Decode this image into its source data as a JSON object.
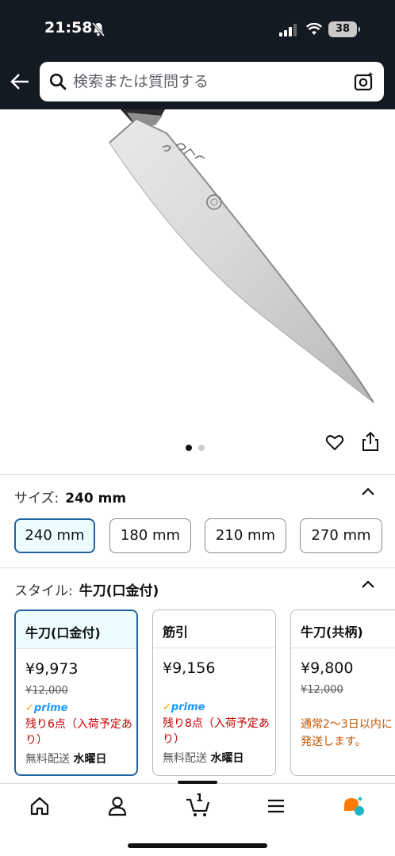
{
  "status_bar": {
    "time": "21:58",
    "battery": "38"
  },
  "header": {
    "search_placeholder": "検索または質問する"
  },
  "size": {
    "label": "サイズ:",
    "value": "240 mm",
    "options": [
      "240 mm",
      "180 mm",
      "210 mm",
      "270 mm"
    ]
  },
  "style": {
    "label": "スタイル:",
    "value": "牛刀(口金付)",
    "cards": [
      {
        "title": "牛刀(口金付)",
        "price": "¥9,973",
        "list_price": "¥12,000",
        "prime": "prime",
        "stock": "残り6点（入荷予定あり）",
        "ship_label": "無料配送",
        "ship_day": "水曜日"
      },
      {
        "title": "筋引",
        "price": "¥9,156",
        "prime": "prime",
        "stock": "残り8点（入荷予定あり）",
        "ship_label": "無料配送",
        "ship_day": "水曜日"
      },
      {
        "title": "牛刀(共柄)",
        "price": "¥9,800",
        "list_price": "¥12,000",
        "note": "通常2～3日以内に発送します。"
      }
    ]
  },
  "bottom_nav": {
    "cart_count": "1"
  },
  "colors": {
    "header_bg": "#131a22",
    "selected_border": "#2162a1",
    "stock_red": "#c40000",
    "note_orange": "#c45500",
    "prime_blue": "#1a98ff"
  }
}
